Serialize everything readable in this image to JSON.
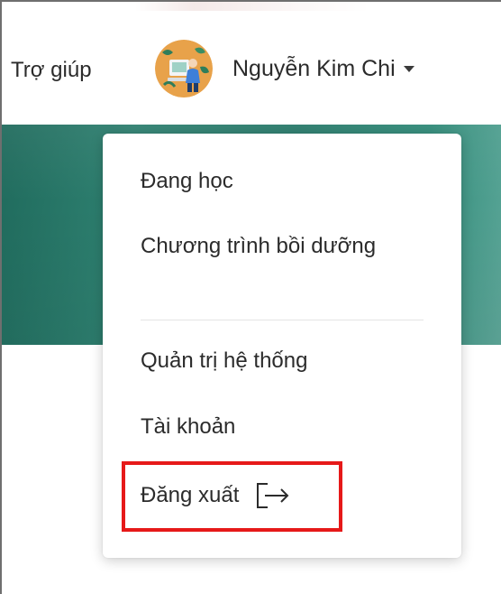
{
  "header": {
    "help_label": "Trợ giúp",
    "user": {
      "name": "Nguyễn Kim Chi",
      "avatar_icon": "avatar-illustration"
    }
  },
  "dropdown": {
    "items": [
      {
        "label": "Đang học"
      },
      {
        "label": "Chương trình bồi dưỡng"
      },
      {
        "label": "Quản trị hệ thống"
      },
      {
        "label": "Tài khoản"
      },
      {
        "label": "Đăng xuất",
        "icon": "logout-icon"
      }
    ]
  },
  "colors": {
    "banner": "#2a7c6c",
    "highlight": "#e61919",
    "text": "#2b2b2b"
  }
}
